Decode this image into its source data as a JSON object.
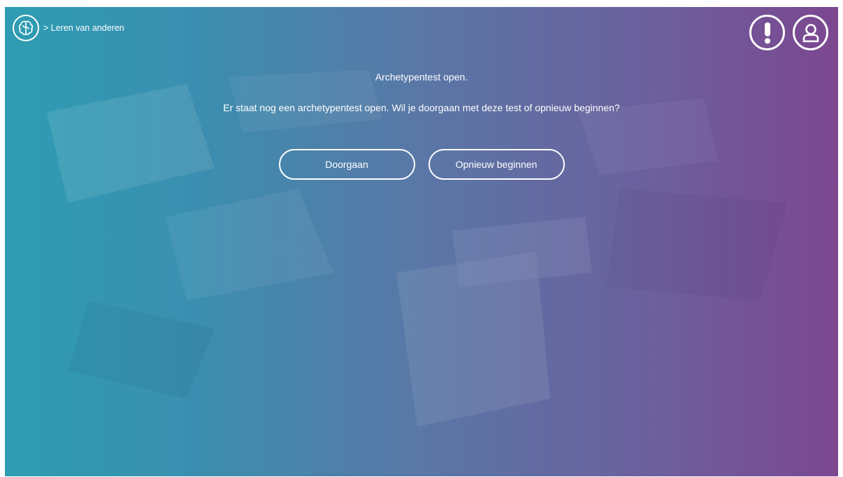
{
  "header": {
    "breadcrumb": "> Leren van anderen",
    "logo_icon": "brain-icon",
    "alert_icon": "exclamation-icon",
    "account_icon": "user-icon"
  },
  "dialog": {
    "title": "Archetypentest open.",
    "message": "Er staat nog een archetypentest open. Wil je doorgaan met deze test of opnieuw beginnen?",
    "continue_label": "Doorgaan",
    "restart_label": "Opnieuw beginnen"
  },
  "colors": {
    "gradient_start": "#2e9db3",
    "gradient_end": "#7c4790",
    "foreground": "#ffffff"
  }
}
